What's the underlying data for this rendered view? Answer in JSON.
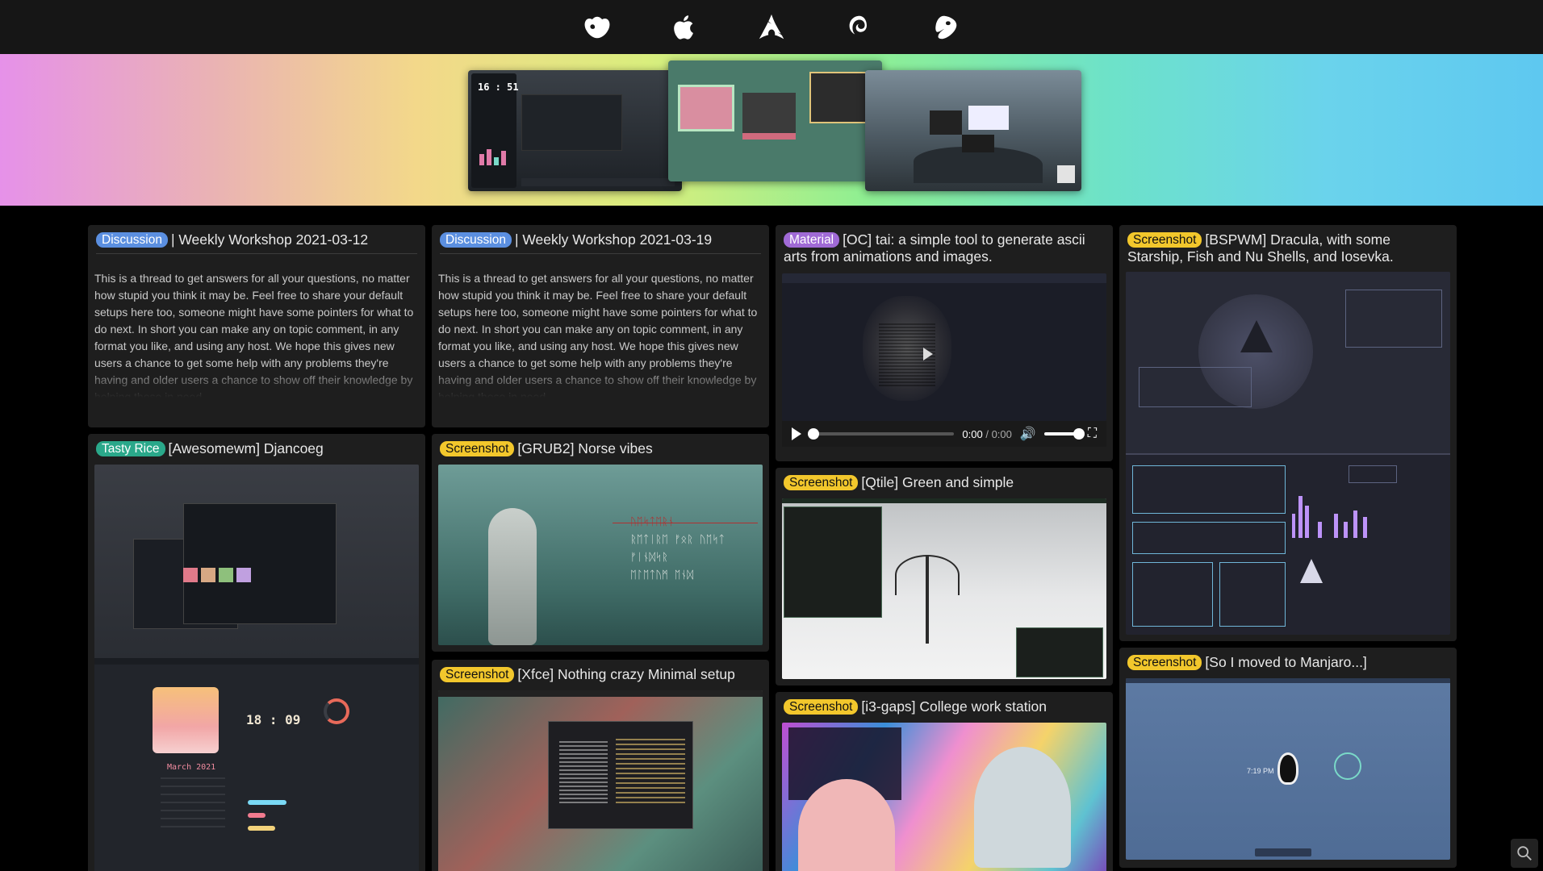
{
  "nav": {
    "icons": [
      "fedora-icon",
      "apple-icon",
      "arch-linux-icon",
      "debian-icon",
      "gentoo-icon"
    ]
  },
  "hero": {
    "clock_time": "16 : 51"
  },
  "cards": [
    {
      "tag": "Discussion",
      "title": "| Weekly Workshop 2021-03-12",
      "body": "This is a thread to get answers for all your questions, no matter how stupid you think it may be. Feel free to share your default setups here too, someone might have some pointers for what to do next. In short you can make any on topic comment, in any format you like, and using any host. We hope this gives new users a chance to get some help with any problems they're having and older users a chance to show off their knowledge by helping those in need."
    },
    {
      "tag": "Discussion",
      "title": "| Weekly Workshop 2021-03-19",
      "body": "This is a thread to get answers for all your questions, no matter how stupid you think it may be. Feel free to share your default setups here too, someone might have some pointers for what to do next. In short you can make any on topic comment, in any format you like, and using any host. We hope this gives new users a chance to get some help with any problems they're having and older users a chance to show off their knowledge by helping those in need."
    },
    {
      "tag": "Material",
      "title": "[OC] tai: a simple tool to generate ascii arts from animations and images.",
      "video": {
        "current": "0:00",
        "separator": "/",
        "duration": "0:00",
        "progress": 0,
        "volume": 1
      }
    },
    {
      "tag": "Screenshot",
      "title": "[BSPWM] Dracula, with some Starship, Fish and Nu Shells, and Iosevka."
    },
    {
      "tag": "Tasty Rice",
      "title": "[Awesomewm] Djancoeg",
      "clock": "18 : 09",
      "calendar_month": "March 2021"
    },
    {
      "tag": "Screenshot",
      "title": "[GRUB2] Norse vibes",
      "runes": [
        "ᚢᛖᛋᛏᛖᚱᚾ",
        "ᚱᛖᛏᛁᚱᛖ ᚠᛟᚱ ᚢᛖᛋᛏ",
        "ᚠᛁᚾᛞᛋᚱ",
        "ᛖᛚᛖᛏᚢᛗ ᛖᚾᛞ"
      ]
    },
    {
      "tag": "Screenshot",
      "title": "[Qtile] Green and simple"
    },
    {
      "tag": "Screenshot",
      "title": "[Xfce] Nothing crazy Minimal setup"
    },
    {
      "tag": "Screenshot",
      "title": "[i3-gaps] College work station"
    },
    {
      "tag": "Screenshot",
      "title": "[So I moved to Manjaro...]",
      "clock": "7:19 PM"
    }
  ]
}
